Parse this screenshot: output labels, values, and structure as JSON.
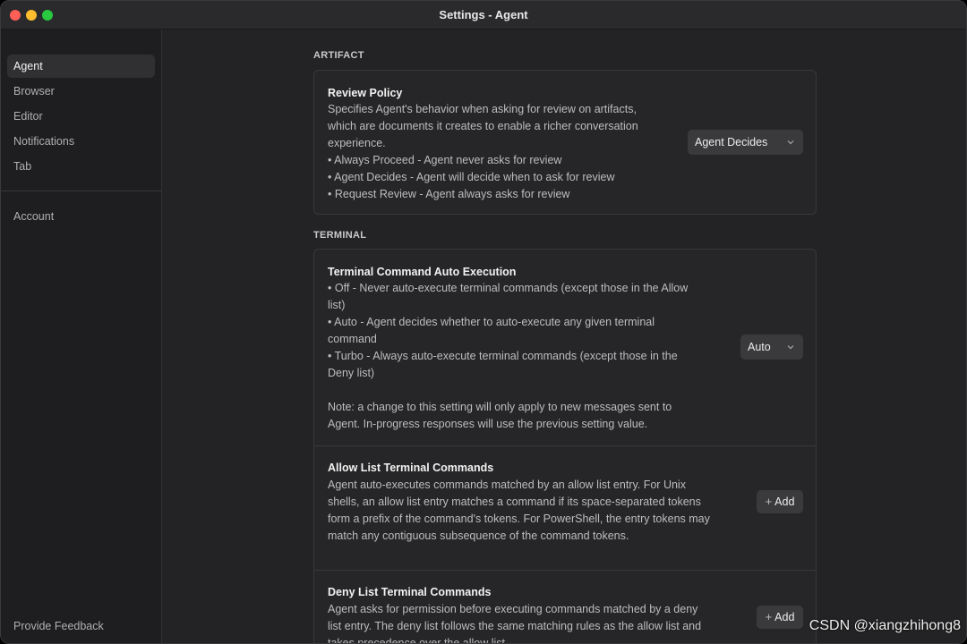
{
  "window": {
    "title": "Settings - Agent"
  },
  "sidebar": {
    "items": [
      {
        "label": "Agent",
        "active": true
      },
      {
        "label": "Browser"
      },
      {
        "label": "Editor"
      },
      {
        "label": "Notifications"
      },
      {
        "label": "Tab"
      }
    ],
    "account": "Account",
    "feedback": "Provide Feedback"
  },
  "sections": {
    "artifact": {
      "label": "ARTIFACT",
      "review_policy": {
        "title": "Review Policy",
        "lines": [
          "Specifies Agent's behavior when asking for review on artifacts,",
          "which are documents it creates to enable a richer conversation",
          "experience.",
          "• Always Proceed - Agent never asks for review",
          "• Agent Decides - Agent will decide when to ask for review",
          "• Request Review - Agent always asks for review"
        ],
        "value": "Agent Decides"
      }
    },
    "terminal": {
      "label": "TERMINAL",
      "auto_execution": {
        "title": "Terminal Command Auto Execution",
        "lines": [
          "• Off - Never auto-execute terminal commands (except those in the Allow",
          "list)",
          "• Auto - Agent decides whether to auto-execute any given terminal",
          "command",
          "• Turbo - Always auto-execute terminal commands (except those in the",
          "Deny list)",
          "",
          "Note: a change to this setting will only apply to new messages sent to",
          "Agent. In-progress responses will use the previous setting value."
        ],
        "value": "Auto"
      },
      "allow_list": {
        "title": "Allow List Terminal Commands",
        "lines": [
          "Agent auto-executes commands matched by an allow list entry. For Unix",
          "shells, an allow list entry matches a command if its space-separated tokens",
          "form a prefix of the command's tokens. For PowerShell, the entry tokens may",
          "match any contiguous subsequence of the command tokens."
        ],
        "button": "Add"
      },
      "deny_list": {
        "title": "Deny List Terminal Commands",
        "lines": [
          "Agent asks for permission before executing commands matched by a deny",
          "list entry. The deny list follows the same matching rules as the allow list and",
          "takes precedence over the allow list."
        ],
        "button": "Add"
      }
    }
  },
  "watermark": "CSDN @xiangzhihong8",
  "icons": {
    "dropdown": "chevron-down-icon",
    "add": "plus-icon"
  }
}
